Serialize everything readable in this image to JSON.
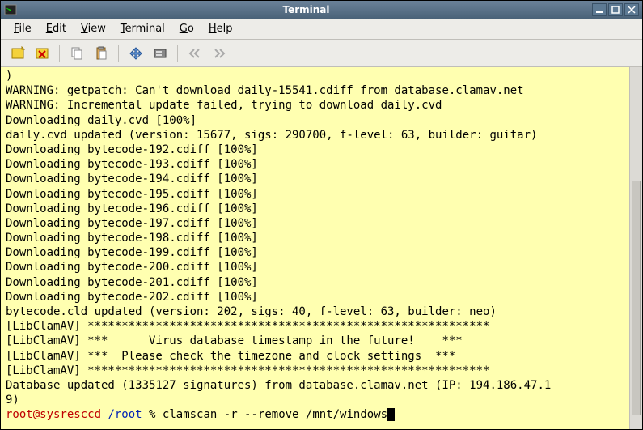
{
  "window": {
    "title": "Terminal"
  },
  "menu": {
    "file": "File",
    "edit": "Edit",
    "view": "View",
    "terminal": "Terminal",
    "go": "Go",
    "help": "Help"
  },
  "terminal": {
    "lines": [
      ")",
      "WARNING: getpatch: Can't download daily-15541.cdiff from database.clamav.net",
      "WARNING: Incremental update failed, trying to download daily.cvd",
      "Downloading daily.cvd [100%]",
      "daily.cvd updated (version: 15677, sigs: 290700, f-level: 63, builder: guitar)",
      "Downloading bytecode-192.cdiff [100%]",
      "Downloading bytecode-193.cdiff [100%]",
      "Downloading bytecode-194.cdiff [100%]",
      "Downloading bytecode-195.cdiff [100%]",
      "Downloading bytecode-196.cdiff [100%]",
      "Downloading bytecode-197.cdiff [100%]",
      "Downloading bytecode-198.cdiff [100%]",
      "Downloading bytecode-199.cdiff [100%]",
      "Downloading bytecode-200.cdiff [100%]",
      "Downloading bytecode-201.cdiff [100%]",
      "Downloading bytecode-202.cdiff [100%]",
      "bytecode.cld updated (version: 202, sigs: 40, f-level: 63, builder: neo)",
      "[LibClamAV] ***********************************************************",
      "[LibClamAV] ***      Virus database timestamp in the future!    ***",
      "[LibClamAV] ***  Please check the timezone and clock settings  ***",
      "[LibClamAV] ***********************************************************",
      "Database updated (1335127 signatures) from database.clamav.net (IP: 194.186.47.1",
      "9)"
    ],
    "prompt_user": "root@sysresccd",
    "prompt_path": "/root",
    "prompt_symbol": " % ",
    "command": "clamscan -r --remove /mnt/windows"
  }
}
